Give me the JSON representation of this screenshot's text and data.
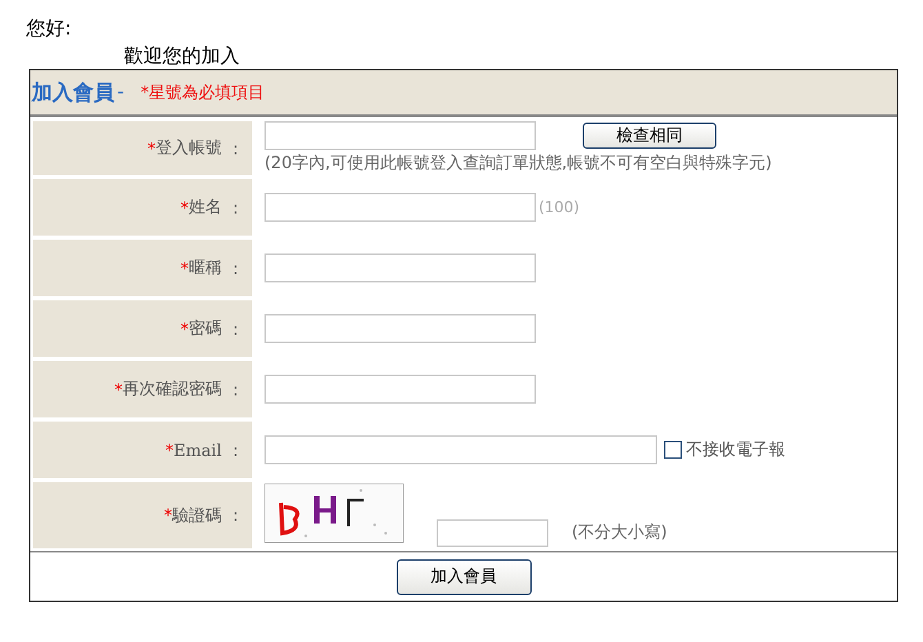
{
  "greeting": "您好:",
  "welcome": "歡迎您的加入",
  "form": {
    "title": "加入會員",
    "title_dash": "-",
    "required_note": "*星號為必填項目",
    "rows": [
      {
        "kind": "account",
        "mark": "*",
        "label": "登入帳號",
        "colon": ":",
        "button": "檢查相同",
        "hint": "(20字內,可使用此帳號登入查詢訂單狀態,帳號不可有空白與特殊字元)"
      },
      {
        "kind": "note",
        "mark": "*",
        "label": "姓名",
        "colon": ":",
        "note": "(100)"
      },
      {
        "kind": "text",
        "mark": "*",
        "label": "暱稱",
        "colon": ":"
      },
      {
        "kind": "password",
        "mark": "*",
        "label": "密碼",
        "colon": ":"
      },
      {
        "kind": "password",
        "mark": "*",
        "label": "再次確認密碼",
        "colon": ":"
      },
      {
        "kind": "email",
        "mark": "*",
        "label": "Email",
        "colon": ":",
        "checkbox": {
          "label": "不接收電子報",
          "checked": false
        }
      },
      {
        "kind": "captcha",
        "mark": "*",
        "label": "驗證碼",
        "colon": ":",
        "hint": "(不分大小寫)"
      }
    ],
    "submit": "加入會員"
  }
}
